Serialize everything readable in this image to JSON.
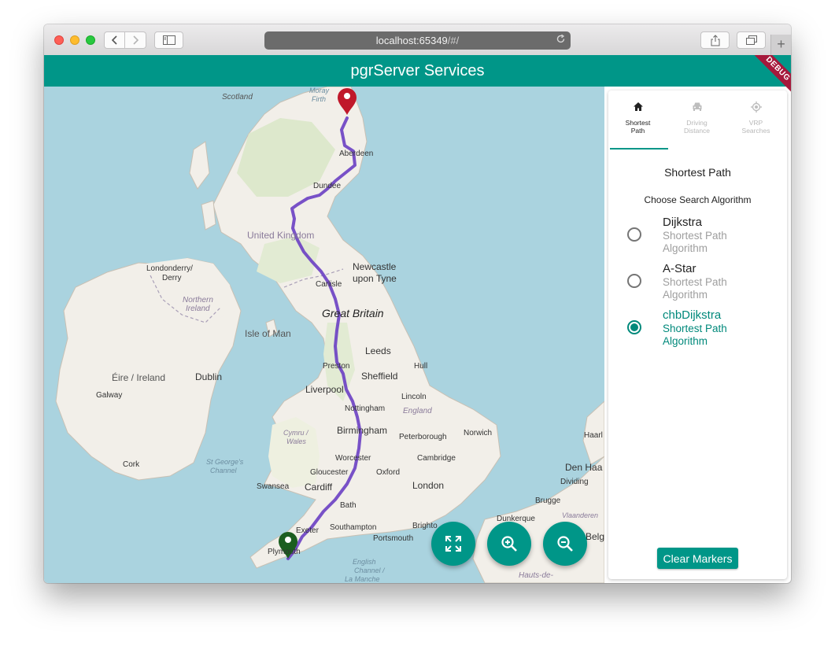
{
  "browser": {
    "url_host": "localhost:65349",
    "url_path": "/#/",
    "plus_label": "+"
  },
  "app": {
    "title": "pgrServer Services",
    "debug_badge": "DEBUG",
    "accent_color": "#009688"
  },
  "map": {
    "labels": {
      "scotland": "Scotland",
      "moray_firth": "Moray",
      "moray_firth2": "Firth",
      "aberdeen": "Aberdeen",
      "dundee": "Dundee",
      "united_kingdom": "United Kingdom",
      "londonderry": "Londonderry/",
      "derry": "Derry",
      "northern_ireland": "Northern",
      "northern_ireland2": "Ireland",
      "newcastle": "Newcastle",
      "upon_tyne": "upon Tyne",
      "carlisle": "Carlisle",
      "great_britain": "Great Britain",
      "isle_of_man": "Isle of Man",
      "leeds": "Leeds",
      "hull": "Hull",
      "preston": "Preston",
      "sheffield": "Sheffield",
      "eire": "Éire / Ireland",
      "dublin": "Dublin",
      "galway": "Galway",
      "liverpool": "Liverpool",
      "lincoln": "Lincoln",
      "nottingham": "Nottingham",
      "england": "England",
      "cymru": "Cymru /",
      "wales": "Wales",
      "birmingham": "Birmingham",
      "peterborough": "Peterborough",
      "norwich": "Norwich",
      "haarlem": "Haarl",
      "cork": "Cork",
      "st_georges": "St George's",
      "channel": "Channel",
      "worcester": "Worcester",
      "cambridge": "Cambridge",
      "gloucester": "Gloucester",
      "oxford": "Oxford",
      "den_haag": "Den Haa",
      "swansea": "Swansea",
      "cardiff": "Cardiff",
      "london": "London",
      "dividing": "Dividing",
      "brugge": "Brugge",
      "bath": "Bath",
      "dunkerque": "Dunkerque",
      "vlaanderen": "Vlaanderen",
      "exeter": "Exeter",
      "southampton": "Southampton",
      "brighton": "Brighto",
      "portsmouth": "Portsmouth",
      "belg": "Belg",
      "plymouth": "Plymouth",
      "english": "English",
      "channel2": "Channel /",
      "lamanche": "La Manche",
      "hauts": "Hauts-de-"
    },
    "route_color": "#6a3fc3",
    "start_marker_color": "#c0182a",
    "end_marker_color": "#1b5e20",
    "fabs": [
      "fullscreen-icon",
      "zoom-in-icon",
      "zoom-out-icon"
    ]
  },
  "panel": {
    "tabs": [
      {
        "icon": "home-icon",
        "label_line1": "Shortest",
        "label_line2": "Path"
      },
      {
        "icon": "car-icon",
        "label_line1": "Driving",
        "label_line2": "Distance"
      },
      {
        "icon": "gps-icon",
        "label_line1": "VRP",
        "label_line2": "Searches"
      }
    ],
    "title": "Shortest Path",
    "subtitle": "Choose Search Algorithm",
    "options": [
      {
        "name": "Dijkstra",
        "desc": "Shortest Path Algorithm",
        "selected": false
      },
      {
        "name": "A-Star",
        "desc": "Shortest Path Algorithm",
        "selected": false
      },
      {
        "name": "chbDijkstra",
        "desc": "Shortest Path Algorithm",
        "selected": true
      }
    ],
    "clear_button": "Clear Markers"
  }
}
